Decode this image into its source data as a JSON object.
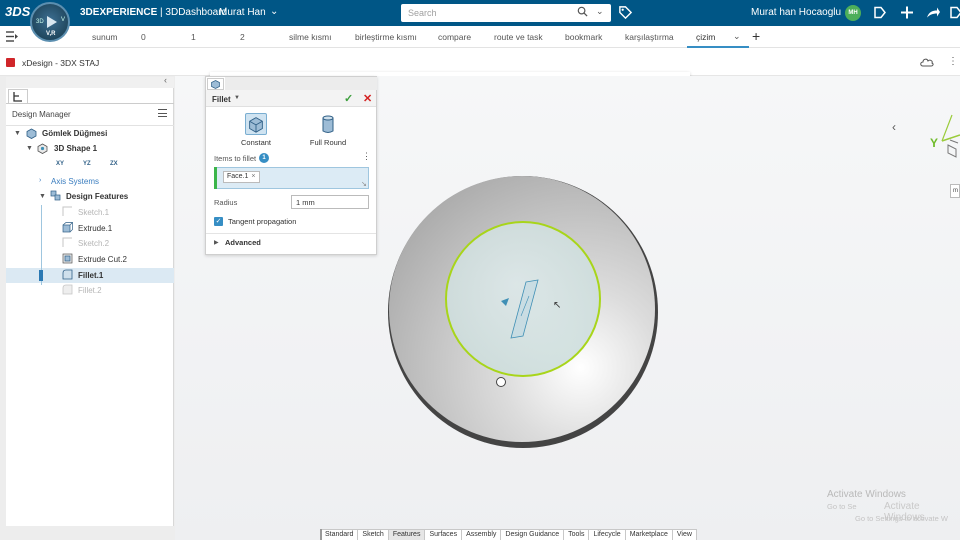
{
  "topbar": {
    "brand_logo": "3DS",
    "brand_bold": "3DEXPERIENCE",
    "brand_rest": " | 3DDashboard",
    "user_short": "Murat Han",
    "compass": {
      "left": "3D",
      "right": "V",
      "bottom": "V,R"
    },
    "search_placeholder": "Search",
    "user_full": "Murat han Hocaoglu",
    "avatar_initials": "MH"
  },
  "tabs": [
    "sunum",
    "0",
    "1",
    "2",
    "silme kısmı",
    "birleştirme kısmı",
    "compare",
    "route ve task",
    "bookmark",
    "karşılaştırma",
    "çizim"
  ],
  "active_tab": "çizim",
  "app": {
    "title": "xDesign - 3DX STAJ"
  },
  "tree": {
    "header": "Design Manager",
    "root": "Gömlek Düğmesi",
    "shape": "3D Shape 1",
    "planes": [
      "XY",
      "YZ",
      "ZX"
    ],
    "axis_systems": "Axis Systems",
    "features_group": "Design Features",
    "features": [
      {
        "label": "Sketch.1",
        "state": "dim"
      },
      {
        "label": "Extrude.1",
        "state": "normal"
      },
      {
        "label": "Sketch.2",
        "state": "dim"
      },
      {
        "label": "Extrude Cut.2",
        "state": "normal"
      },
      {
        "label": "Fillet.1",
        "state": "selected"
      },
      {
        "label": "Fillet.2",
        "state": "dim"
      }
    ]
  },
  "fillet_panel": {
    "title": "Fillet",
    "modes": [
      "Constant",
      "Full Round"
    ],
    "items_label": "Items to fillet",
    "items_count": "1",
    "item_chip": "Face.1",
    "radius_label": "Radius",
    "radius_value": "1 mm",
    "tangent_label": "Tangent propagation",
    "advanced_label": "Advanced"
  },
  "watermark": {
    "title": "Activate Windows",
    "line1": "Go to Se",
    "overlay": "Activate Windows",
    "line2": "Go to Settings to activate W"
  },
  "side_button": "m",
  "axis_label": "Y",
  "action_bar": [
    "Standard",
    "Sketch",
    "Features",
    "Surfaces",
    "Assembly",
    "Design Guidance",
    "Tools",
    "Lifecycle",
    "Marketplace",
    "View"
  ],
  "action_bar_active": "Features",
  "colors": {
    "topbar": "#005686",
    "accent": "#368ec4",
    "selection": "#a8d51a",
    "confirm": "#3d9f3d",
    "cancel": "#d42222"
  }
}
